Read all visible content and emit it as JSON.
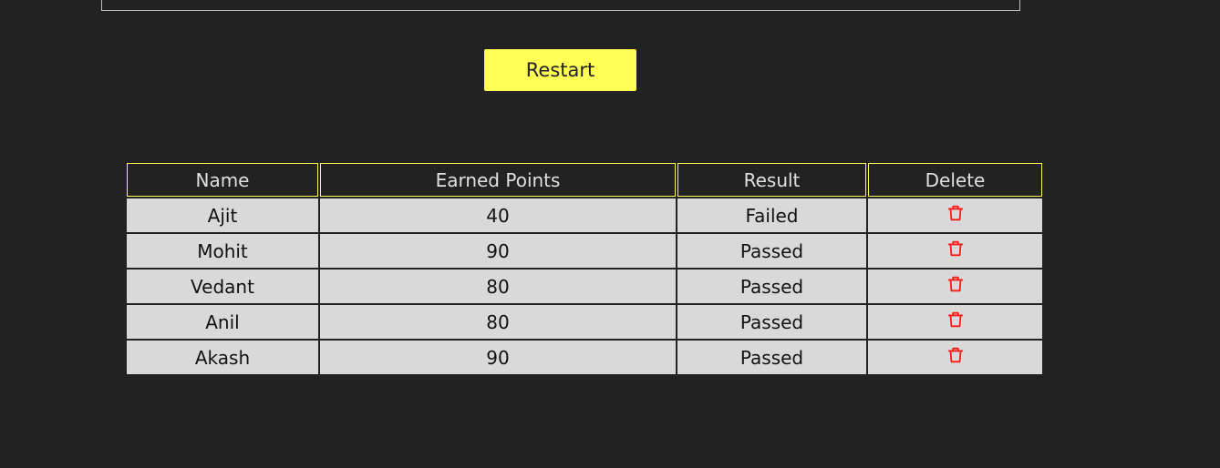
{
  "restart_label": "Restart",
  "table": {
    "headers": {
      "name": "Name",
      "points": "Earned Points",
      "result": "Result",
      "delete": "Delete"
    },
    "rows": [
      {
        "name": "Ajit",
        "points": "40",
        "result": "Failed",
        "status": "failed"
      },
      {
        "name": "Mohit",
        "points": "90",
        "result": "Passed",
        "status": "passed"
      },
      {
        "name": "Vedant",
        "points": "80",
        "result": "Passed",
        "status": "passed"
      },
      {
        "name": "Anil",
        "points": "80",
        "result": "Passed",
        "status": "passed"
      },
      {
        "name": "Akash",
        "points": "90",
        "result": "Passed",
        "status": "passed"
      }
    ]
  },
  "colors": {
    "background": "#222222",
    "accent": "#ffff55",
    "failed": "#ff2d6e",
    "passed": "#22ee77",
    "delete_icon": "#ff1a1a",
    "row_background": "#d9d9d9"
  },
  "icons": {
    "delete": "trash-icon"
  }
}
